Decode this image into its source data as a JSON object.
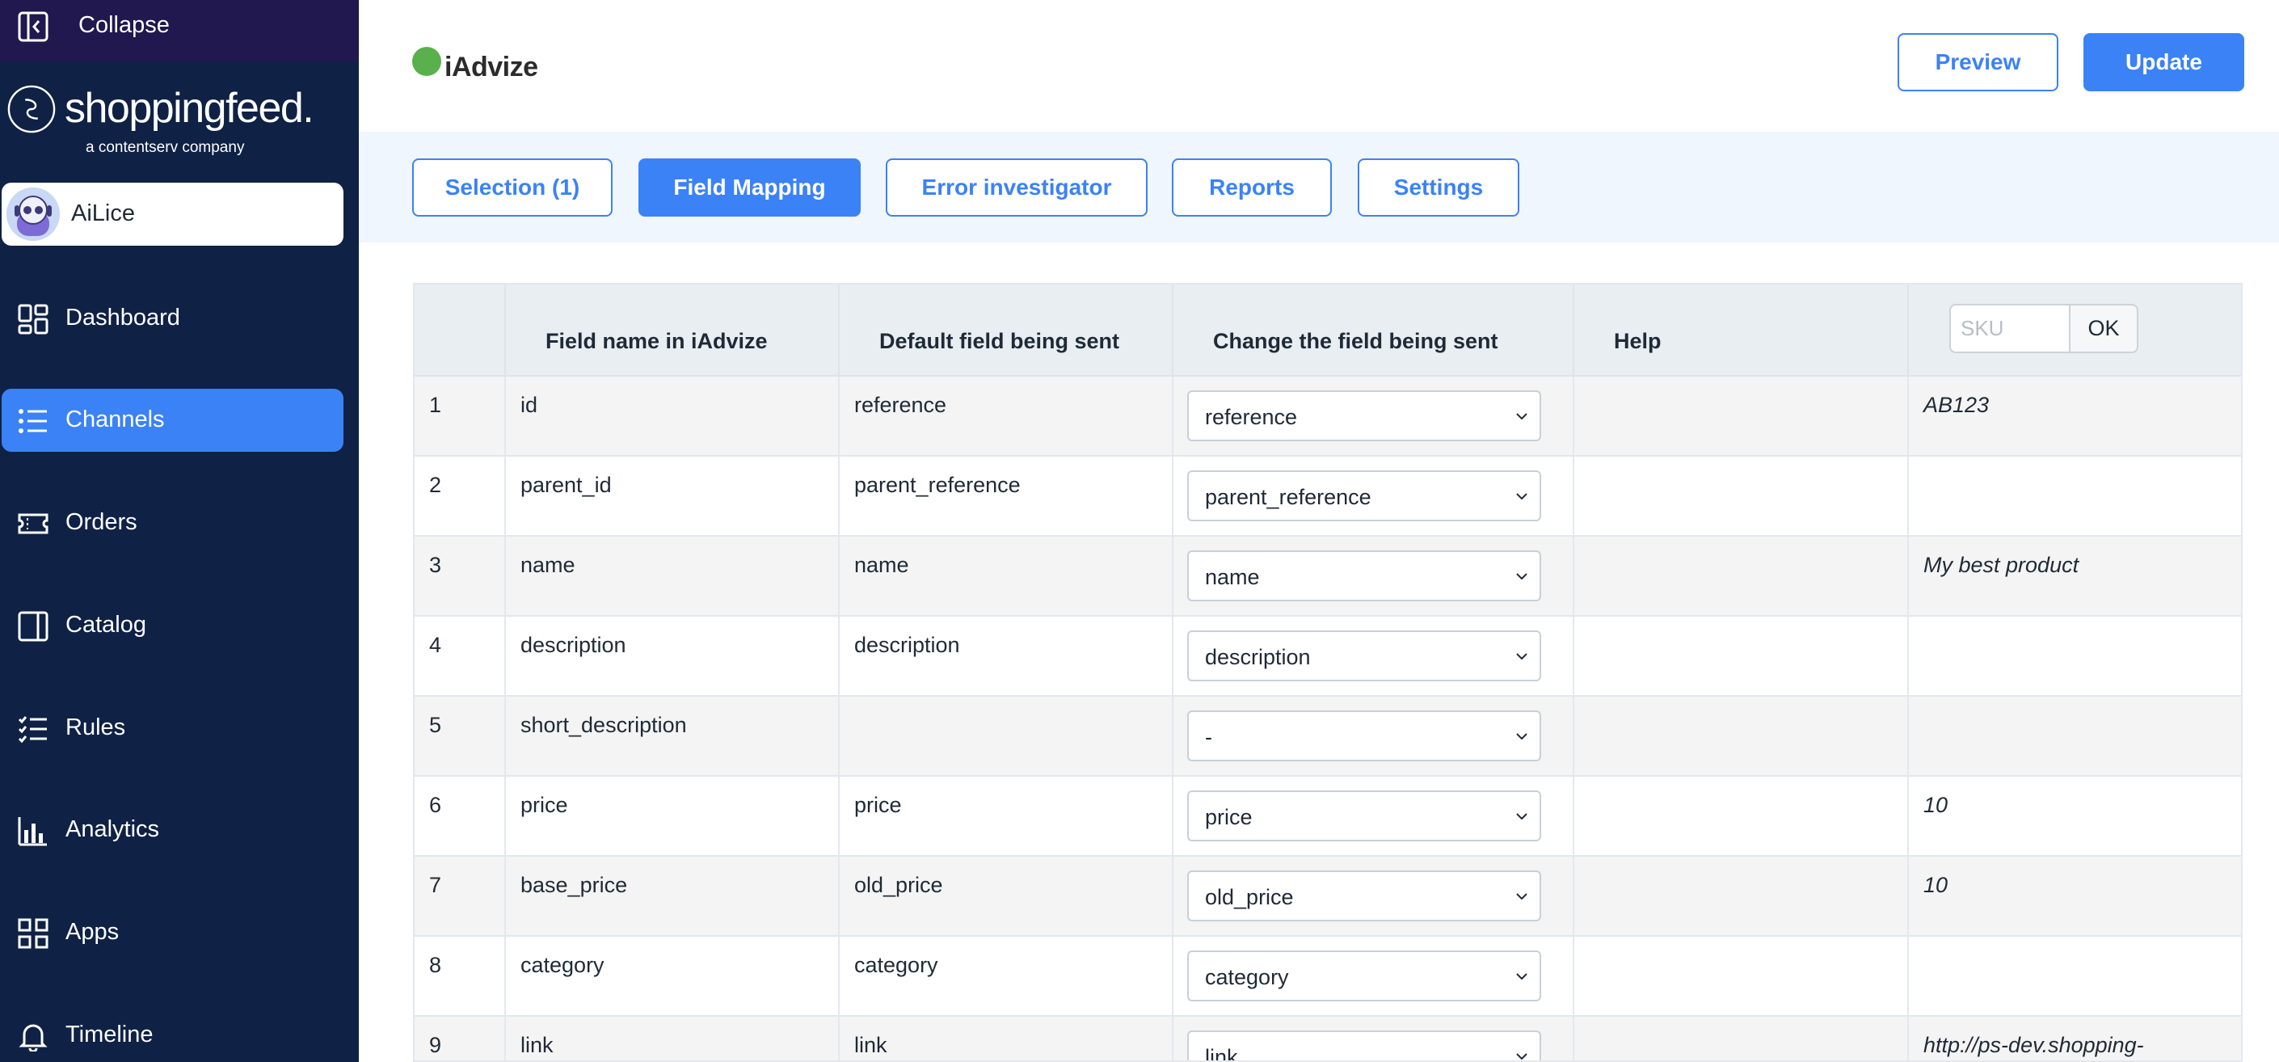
{
  "sidebar": {
    "collapse_label": "Collapse",
    "brand_name": "shoppingfeed.",
    "brand_tagline": "a contentserv company",
    "user_name": "AiLice",
    "items": [
      {
        "label": "Dashboard",
        "icon": "dashboard-icon"
      },
      {
        "label": "Channels",
        "icon": "list-icon",
        "active": true
      },
      {
        "label": "Orders",
        "icon": "ticket-icon"
      },
      {
        "label": "Catalog",
        "icon": "book-icon"
      },
      {
        "label": "Rules",
        "icon": "checklist-icon"
      },
      {
        "label": "Analytics",
        "icon": "bar-chart-icon"
      },
      {
        "label": "Apps",
        "icon": "apps-grid-icon"
      },
      {
        "label": "Timeline",
        "icon": "bell-icon"
      }
    ]
  },
  "header": {
    "channel_logo": "iAdvize",
    "preview_label": "Preview",
    "update_label": "Update"
  },
  "tabs": [
    {
      "label": "Selection (1)"
    },
    {
      "label": "Field Mapping",
      "active": true
    },
    {
      "label": "Error investigator"
    },
    {
      "label": "Reports"
    },
    {
      "label": "Settings"
    }
  ],
  "table": {
    "headers": {
      "num": "",
      "field_name": "Field name in iAdvize",
      "default_field": "Default field being sent",
      "change_field": "Change the field being sent",
      "help": "Help"
    },
    "sku": {
      "placeholder": "SKU",
      "ok_label": "OK"
    },
    "rows": [
      {
        "num": "1",
        "field": "id",
        "default": "reference",
        "selected": "reference",
        "help": "",
        "example": "AB123"
      },
      {
        "num": "2",
        "field": "parent_id",
        "default": "parent_reference",
        "selected": "parent_reference",
        "help": "",
        "example": ""
      },
      {
        "num": "3",
        "field": "name",
        "default": "name",
        "selected": "name",
        "help": "",
        "example": "My best product"
      },
      {
        "num": "4",
        "field": "description",
        "default": "description",
        "selected": "description",
        "help": "",
        "example": ""
      },
      {
        "num": "5",
        "field": "short_description",
        "default": "",
        "selected": "-",
        "help": "",
        "example": ""
      },
      {
        "num": "6",
        "field": "price",
        "default": "price",
        "selected": "price",
        "help": "",
        "example": "10"
      },
      {
        "num": "7",
        "field": "base_price",
        "default": "old_price",
        "selected": "old_price",
        "help": "",
        "example": "10"
      },
      {
        "num": "8",
        "field": "category",
        "default": "category",
        "selected": "category",
        "help": "",
        "example": ""
      },
      {
        "num": "9",
        "field": "link",
        "default": "link",
        "selected": "link",
        "help": "",
        "example": "http://ps-dev.shopping-"
      }
    ]
  },
  "colors": {
    "sidebar_bg": "#0f2145",
    "collapse_bg": "#20184e",
    "accent": "#3b82f6",
    "tabs_band_bg": "#eff6fe",
    "logo_green": "#5ab04c"
  }
}
